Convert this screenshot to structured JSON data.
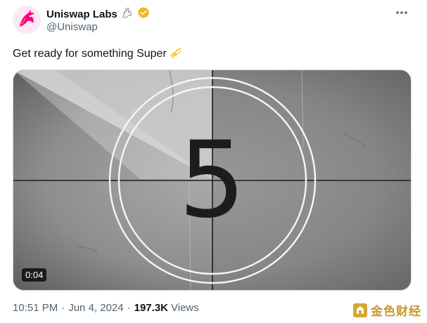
{
  "author": {
    "name": "Uniswap Labs",
    "handle": "@Uniswap",
    "verified": true,
    "avatar_icon": "uniswap-unicorn-logo",
    "name_emoji_icon": "unicorn-icon",
    "badge_color": "#e8b828"
  },
  "tweet": {
    "text": "Get ready for something Super",
    "emoji_icon": "dizzy-star-icon"
  },
  "media": {
    "type": "video",
    "countdown_number": "5",
    "duration": "0:04"
  },
  "meta": {
    "time": "10:51 PM",
    "date": "Jun 4, 2024",
    "views_count": "197.3K",
    "views_label": "Views"
  },
  "watermark": {
    "text": "金色财经"
  },
  "colors": {
    "text_primary": "#0f1419",
    "text_secondary": "#536471",
    "brand_pink": "#ff007a"
  }
}
